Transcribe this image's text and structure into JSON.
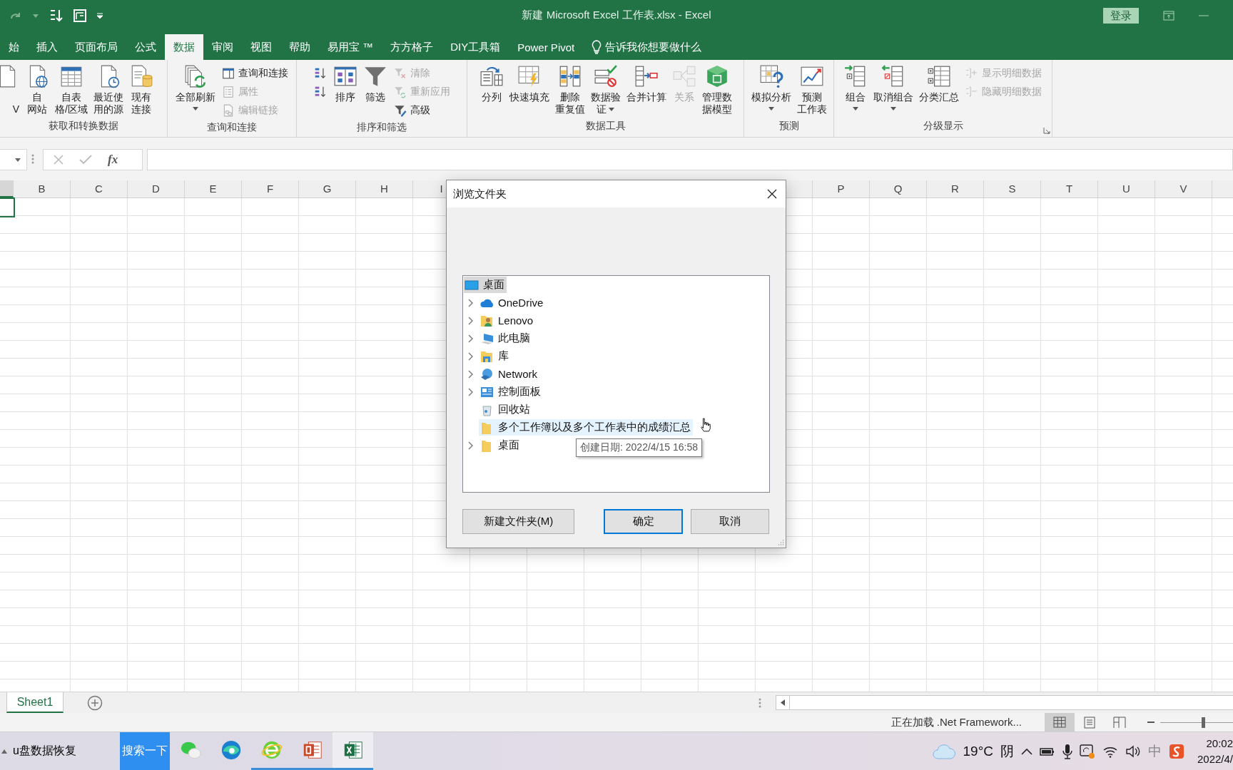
{
  "title_bar": {
    "title": "新建 Microsoft Excel 工作表.xlsx - Excel",
    "sign_in": "登录"
  },
  "tabs": [
    {
      "label": "始",
      "selected": false
    },
    {
      "label": "插入",
      "selected": false
    },
    {
      "label": "页面布局",
      "selected": false
    },
    {
      "label": "公式",
      "selected": false
    },
    {
      "label": "数据",
      "selected": true
    },
    {
      "label": "审阅",
      "selected": false
    },
    {
      "label": "视图",
      "selected": false
    },
    {
      "label": "帮助",
      "selected": false
    },
    {
      "label": "易用宝 ™",
      "selected": false
    },
    {
      "label": "方方格子",
      "selected": false
    },
    {
      "label": "DIY工具箱",
      "selected": false
    },
    {
      "label": "Power Pivot",
      "selected": false
    }
  ],
  "tell_me": "告诉我你想要做什么",
  "ribbon": [
    {
      "label": "获取和转换数据",
      "items": [
        {
          "kind": "large",
          "lines": [
            "V"
          ],
          "disabled": false
        },
        {
          "kind": "large",
          "lines": [
            "自",
            "网站"
          ],
          "disabled": false
        },
        {
          "kind": "large",
          "lines": [
            "自表",
            "格/区域"
          ],
          "disabled": false
        },
        {
          "kind": "large",
          "lines": [
            "最近使",
            "用的源"
          ],
          "disabled": false
        },
        {
          "kind": "large",
          "lines": [
            "现有",
            "连接"
          ],
          "disabled": false
        }
      ]
    },
    {
      "label": "查询和连接",
      "items": [
        {
          "kind": "large",
          "lines": [
            "全部刷新"
          ],
          "disabled": false,
          "dropdown": true
        },
        {
          "kind": "stack",
          "items": [
            {
              "kind": "small",
              "label": "查询和连接",
              "disabled": false
            },
            {
              "kind": "small",
              "label": "属性",
              "disabled": true
            },
            {
              "kind": "small",
              "label": "编辑链接",
              "disabled": true
            }
          ]
        }
      ]
    },
    {
      "label": "排序和筛选",
      "items": [
        {
          "kind": "stack",
          "items": [
            {
              "kind": "small",
              "disabled": false
            },
            {
              "kind": "small",
              "disabled": false
            }
          ]
        },
        {
          "kind": "large",
          "lines": [
            "排序"
          ],
          "disabled": false
        },
        {
          "kind": "large",
          "lines": [
            "筛选"
          ],
          "disabled": false
        },
        {
          "kind": "stack",
          "items": [
            {
              "kind": "small",
              "label": "清除",
              "disabled": true
            },
            {
              "kind": "small",
              "label": "重新应用",
              "disabled": true
            },
            {
              "kind": "small",
              "label": "高级",
              "disabled": false
            }
          ]
        }
      ]
    },
    {
      "label": "数据工具",
      "items": [
        {
          "kind": "large",
          "lines": [
            "分列"
          ],
          "disabled": false
        },
        {
          "kind": "large",
          "lines": [
            "快速填充"
          ],
          "disabled": false
        },
        {
          "kind": "large",
          "lines": [
            "删除",
            "重复值"
          ],
          "disabled": false
        },
        {
          "kind": "large",
          "lines": [
            "数据验",
            "证"
          ],
          "disabled": false,
          "dropdown": true
        },
        {
          "kind": "large",
          "lines": [
            "合并计算"
          ],
          "disabled": false
        },
        {
          "kind": "large",
          "lines": [
            "关系"
          ],
          "disabled": true
        },
        {
          "kind": "large",
          "lines": [
            "管理数",
            "据模型"
          ],
          "disabled": false
        }
      ]
    },
    {
      "label": "预测",
      "items": [
        {
          "kind": "large",
          "lines": [
            "模拟分析"
          ],
          "disabled": false,
          "dropdown": true
        },
        {
          "kind": "large",
          "lines": [
            "预测",
            "工作表"
          ],
          "disabled": false
        }
      ]
    },
    {
      "label": "分级显示",
      "items": [
        {
          "kind": "large",
          "lines": [
            "组合"
          ],
          "disabled": false,
          "dropdown": true
        },
        {
          "kind": "large",
          "lines": [
            "取消组合"
          ],
          "disabled": false,
          "dropdown": true
        },
        {
          "kind": "large",
          "lines": [
            "分类汇总"
          ],
          "disabled": false
        },
        {
          "kind": "stack",
          "items": [
            {
              "kind": "small",
              "label": "显示明细数据",
              "disabled": true
            },
            {
              "kind": "small",
              "label": "隐藏明细数据",
              "disabled": true
            }
          ]
        }
      ]
    }
  ],
  "formula_bar": {
    "function_label": "fx"
  },
  "sheet": {
    "columns_left": [
      "B",
      "C",
      "D",
      "E",
      "F",
      "G",
      "H",
      "I"
    ],
    "columns_right": [
      "P",
      "Q",
      "R",
      "S",
      "T",
      "U",
      "V"
    ]
  },
  "dialog": {
    "title": "浏览文件夹",
    "tree": {
      "label": "桌面",
      "selected": true,
      "children": [
        {
          "label": "OneDrive",
          "selected": false,
          "highlighted": false,
          "expandable": true
        },
        {
          "label": "Lenovo",
          "selected": false,
          "highlighted": false,
          "expandable": true
        },
        {
          "label": "此电脑",
          "selected": false,
          "highlighted": false,
          "expandable": true
        },
        {
          "label": "库",
          "selected": false,
          "highlighted": false,
          "expandable": true
        },
        {
          "label": "Network",
          "selected": false,
          "highlighted": false,
          "expandable": true
        },
        {
          "label": "控制面板",
          "selected": false,
          "highlighted": false,
          "expandable": true
        },
        {
          "label": "回收站",
          "selected": false,
          "highlighted": false,
          "expandable": false
        },
        {
          "label": "多个工作簿以及多个工作表中的成绩汇总",
          "selected": false,
          "highlighted": true,
          "expandable": false
        },
        {
          "label": "桌面",
          "selected": false,
          "highlighted": false,
          "expandable": true
        }
      ]
    },
    "tooltip": "创建日期: 2022/4/15 16:58",
    "buttons": [
      {
        "label": "新建文件夹(M)",
        "default": false
      },
      {
        "label": "确定",
        "default": true
      },
      {
        "label": "取消",
        "default": false
      }
    ]
  },
  "sheet_tabs": [
    {
      "label": "Sheet1",
      "selected": true
    }
  ],
  "status_bar": {
    "message": "正在加载 .Net Framework...",
    "views": [
      {
        "selected": true
      },
      {
        "selected": false
      },
      {
        "selected": false
      }
    ],
    "zoom": {
      "level": 0.5
    }
  },
  "taskbar": {
    "pinned_text": "u盘数据恢复",
    "search_button": "搜索一下",
    "apps": [
      {
        "running": false,
        "selected": false
      },
      {
        "running": false,
        "selected": false
      },
      {
        "running": true,
        "selected": false
      },
      {
        "running": true,
        "selected": false
      },
      {
        "running": true,
        "selected": true
      }
    ],
    "temperature": "19°C",
    "weather": "阴",
    "ime": "中",
    "time": "20:02",
    "date": "2022/4/"
  }
}
